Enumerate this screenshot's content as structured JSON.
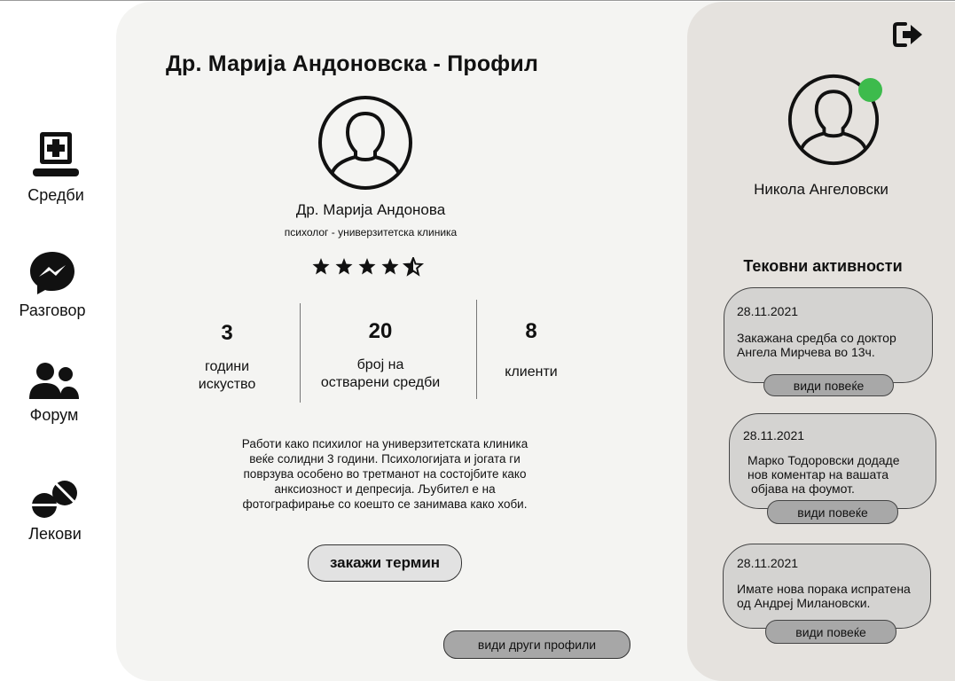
{
  "nav": {
    "items": [
      {
        "label": "Средби",
        "icon": "medical-laptop-icon"
      },
      {
        "label": "Разговор",
        "icon": "messenger-icon"
      },
      {
        "label": "Форум",
        "icon": "users-icon"
      },
      {
        "label": "Лекови",
        "icon": "pills-icon"
      }
    ]
  },
  "profile": {
    "page_title": "Др. Марија Андоновска - Профил",
    "name": "Др. Марија Андонова",
    "role": "психолог - универзитетска клиника",
    "rating": 4.5,
    "stats": [
      {
        "value": "3",
        "label_line1": "години",
        "label_line2": "искуство"
      },
      {
        "value": "20",
        "label_line1": "број на",
        "label_line2": "остварени средби"
      },
      {
        "value": "8",
        "label_line1": "клиенти",
        "label_line2": ""
      }
    ],
    "bio_lines": [
      "Работи како психилог на универзитетската клиника",
      "веќе солидни 3 години. Психологијата и јогата ги",
      "поврзува особено во третманот на состојбите како",
      "анксиозност и депресија. Љубител е на",
      "фотографирање со коешто се занимава како хоби."
    ],
    "book_button": "закажи термин",
    "others_button": "види други профили"
  },
  "user": {
    "name": "Никола Ангеловски",
    "online_color": "#3dbb4c"
  },
  "activities": {
    "title": "Тековни активности",
    "more_label": "види повеќе",
    "items": [
      {
        "date": "28.11.2021",
        "line1": "Закажана средба со доктор",
        "line2": "Ангела Мирчева во 13ч.",
        "line3": ""
      },
      {
        "date": "28.11.2021",
        "line1": "Марко Тодоровски додаде",
        "line2": "нов коментар на вашата",
        "line3": "објава на фоумот."
      },
      {
        "date": "28.11.2021",
        "line1": "Имате нова порака испратена",
        "line2": "од Андреј Милановски.",
        "line3": ""
      }
    ]
  },
  "icons": {
    "logout": "logout-icon",
    "avatar": "user-avatar-icon",
    "star": "star-icon"
  }
}
